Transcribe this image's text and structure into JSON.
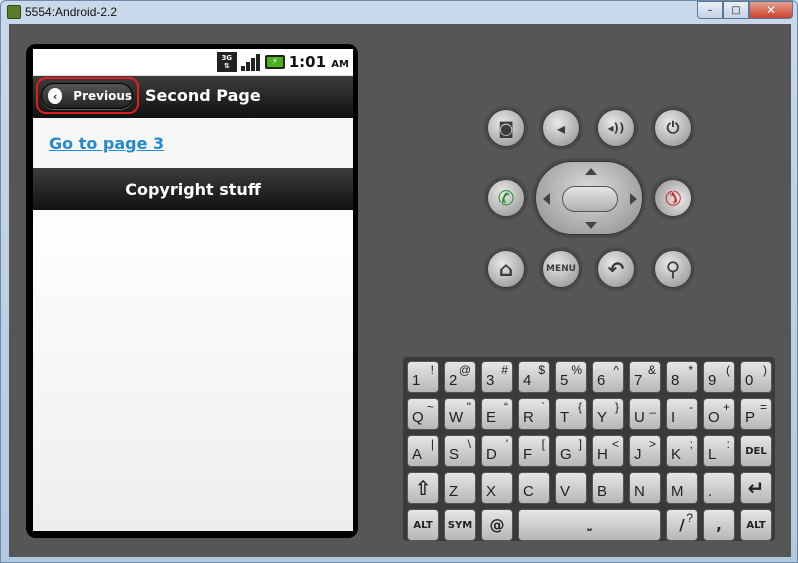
{
  "window": {
    "title": "5554:Android-2.2",
    "minimize": "–",
    "maximize": "□",
    "close": "✕"
  },
  "statusbar": {
    "network": "3G",
    "battery_glyph": "⚡",
    "time": "1:01",
    "ampm": "AM"
  },
  "header": {
    "back_label": "Previous",
    "back_icon": "‹",
    "title": "Second Page"
  },
  "content": {
    "link": "Go to page 3"
  },
  "footer": {
    "text": "Copyright stuff"
  },
  "controls": {
    "camera": "◙",
    "vol_down": "◂",
    "vol_up": "◂))",
    "power": "⏻",
    "call": "✆",
    "end": "✆",
    "home": "⌂",
    "menu": "MENU",
    "back": "↶",
    "search": "⚲"
  },
  "keyboard": {
    "row1": [
      {
        "m": "1",
        "a": "!"
      },
      {
        "m": "2",
        "a": "@"
      },
      {
        "m": "3",
        "a": "#"
      },
      {
        "m": "4",
        "a": "$"
      },
      {
        "m": "5",
        "a": "%"
      },
      {
        "m": "6",
        "a": "^"
      },
      {
        "m": "7",
        "a": "&"
      },
      {
        "m": "8",
        "a": "*"
      },
      {
        "m": "9",
        "a": "("
      },
      {
        "m": "0",
        "a": ")"
      }
    ],
    "row2": [
      {
        "m": "Q",
        "a": "~"
      },
      {
        "m": "W",
        "a": "\""
      },
      {
        "m": "E",
        "a": "“"
      },
      {
        "m": "R",
        "a": "`"
      },
      {
        "m": "T",
        "a": "{"
      },
      {
        "m": "Y",
        "a": "}"
      },
      {
        "m": "U",
        "a": "_"
      },
      {
        "m": "I",
        "a": "-"
      },
      {
        "m": "O",
        "a": "+"
      },
      {
        "m": "P",
        "a": "="
      }
    ],
    "row3": [
      {
        "m": "A",
        "a": "|"
      },
      {
        "m": "S",
        "a": "\\"
      },
      {
        "m": "D",
        "a": "'"
      },
      {
        "m": "F",
        "a": "["
      },
      {
        "m": "G",
        "a": "]"
      },
      {
        "m": "H",
        "a": "<"
      },
      {
        "m": "J",
        "a": ">"
      },
      {
        "m": "K",
        "a": ";"
      },
      {
        "m": "L",
        "a": ":"
      },
      {
        "m": "DEL",
        "a": ""
      }
    ],
    "row4": [
      {
        "m": "⇧",
        "a": ""
      },
      {
        "m": "Z",
        "a": ""
      },
      {
        "m": "X",
        "a": ""
      },
      {
        "m": "C",
        "a": ""
      },
      {
        "m": "V",
        "a": ""
      },
      {
        "m": "B",
        "a": ""
      },
      {
        "m": "N",
        "a": ""
      },
      {
        "m": "M",
        "a": ""
      },
      {
        "m": ".",
        "a": ""
      },
      {
        "m": "↵",
        "a": ""
      }
    ],
    "row5": {
      "alt_left": "ALT",
      "sym": "SYM",
      "at": "@",
      "space": "⎵",
      "slash": "/",
      "slash_alt": "?",
      "comma": ",",
      "alt_right": "ALT"
    }
  }
}
